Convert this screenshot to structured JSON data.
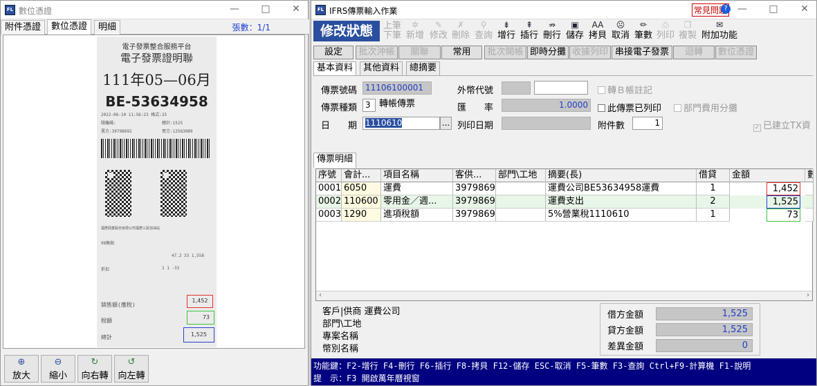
{
  "left_window": {
    "title": "數位憑證",
    "controls": {
      "min": "—",
      "max": "□",
      "close": "✕"
    },
    "tabs": [
      "附件憑證",
      "數位憑證",
      "明細"
    ],
    "page_count": "張數：1/1",
    "receipt": {
      "header": "電子發票整合服務平台",
      "title": "電子發票證明聯",
      "period": "111年05—06月",
      "number": "BE-53634958",
      "line1": "2022-06-10 11:56:23  格式:25",
      "line2a": "隨機碼:",
      "line2b": "總計:1525",
      "line3a": "賣方:39798692",
      "line3b": "買方:12563089",
      "seller": "福懋興業股份有限公司福懋三民加油站",
      "item": "98無鉛",
      "item_row1": "47.2  33  1,558",
      "item_row2a": "折扣",
      "item_row2b": "1     1   -33",
      "sales_label": "銷售額(應稅)",
      "sales_value": "1,452",
      "tax_label": "稅額",
      "tax_value": "73",
      "total_label": "總計",
      "total_value": "1,525"
    },
    "buttons": [
      {
        "icon": "⊕",
        "label": "放大"
      },
      {
        "icon": "⊖",
        "label": "縮小"
      },
      {
        "icon": "↻",
        "label": "向右轉"
      },
      {
        "icon": "↺",
        "label": "向左轉"
      }
    ]
  },
  "right_window": {
    "title": "IFRS傳票輸入作業",
    "help_badge": "常見問題",
    "help_icon": "?",
    "controls": {
      "min": "—",
      "max": "□",
      "close": "✕"
    },
    "state": "修改狀態",
    "toolbar": [
      {
        "icon": "▲",
        "label": "上筆",
        "enabled": false
      },
      {
        "icon": "✲",
        "label": "新增",
        "enabled": false
      },
      {
        "icon": "✎",
        "label": "修改",
        "enabled": false
      },
      {
        "icon": "✗",
        "label": "刪除",
        "enabled": false
      },
      {
        "icon": "⚲",
        "label": "查詢",
        "enabled": false
      },
      {
        "icon": "⇟",
        "label": "增行",
        "enabled": true
      },
      {
        "icon": "⇞",
        "label": "插行",
        "enabled": true
      },
      {
        "icon": "⇏",
        "label": "刪行",
        "enabled": true
      },
      {
        "icon": "▣",
        "label": "儲存",
        "enabled": true
      },
      {
        "icon": "AA",
        "label": "拷貝",
        "enabled": true
      },
      {
        "icon": "☹",
        "label": "取消",
        "enabled": true
      },
      {
        "icon": "✏",
        "label": "筆數",
        "enabled": true
      },
      {
        "icon": "⎙",
        "label": "列印",
        "enabled": false
      },
      {
        "icon": "❐",
        "label": "複製",
        "enabled": false
      },
      {
        "icon": "✉",
        "label": "附加功能",
        "enabled": true
      }
    ],
    "toolbar_row2": [
      "下筆"
    ],
    "func_buttons": [
      {
        "label": "設定",
        "enabled": true
      },
      {
        "label": "批次沖帳",
        "enabled": false
      },
      {
        "label": "關聯",
        "enabled": false
      },
      {
        "label": "常用",
        "enabled": true
      },
      {
        "label": "批次開帳",
        "enabled": false
      },
      {
        "label": "即時分攤",
        "enabled": true
      },
      {
        "label": "收據列印",
        "enabled": false
      },
      {
        "label": "串接電子發票",
        "enabled": true
      },
      {
        "label": "迴轉",
        "enabled": false
      },
      {
        "label": "數位憑證",
        "enabled": false
      }
    ],
    "panel_tabs": [
      "基本資料",
      "其他資料",
      "總摘要"
    ],
    "basic": {
      "voucher_no_label": "傳票號碼",
      "voucher_no": "11106100001",
      "voucher_type_label": "傳票種類",
      "voucher_type_code": "3",
      "voucher_type_name": "轉帳傳票",
      "date_label": "日　　期",
      "date": "1110610",
      "date_btn": "...",
      "currency_label": "外幣代號",
      "currency": "",
      "rate_label": "匯　　率",
      "rate": "1.0000",
      "print_date_label": "列印日期",
      "print_date": "",
      "attach_label": "附件數",
      "attach": "1",
      "chk_transfer_b": "轉Ｂ帳註記",
      "chk_printed": "此傳票已列印",
      "chk_dept_alloc": "部門費用分攤",
      "chk_tx": "已建立TX資"
    },
    "detail_tab": "傳票明細",
    "grid": {
      "headers": [
        "序號",
        "會計...",
        "項目名稱",
        "客供...",
        "部門\\工地",
        "摘要(長)",
        "借貸",
        "金額",
        "數"
      ],
      "rows": [
        [
          "0001",
          "6050",
          "運費",
          "39798692",
          "",
          "運費公司BE53634958運費",
          "1",
          "1,452"
        ],
        [
          "0002",
          "110600",
          "零用金／週...",
          "39798692",
          "",
          "運費支出",
          "2",
          "1,525"
        ],
        [
          "0003",
          "1290",
          "進項稅額",
          "39798692",
          "",
          "5%營業稅1110610",
          "1",
          "73"
        ]
      ]
    },
    "footer_left": {
      "customer": "客戶|供商 運費公司",
      "dept": "部門\\工地",
      "project": "專案名稱",
      "currency": "幣別名稱"
    },
    "totals": {
      "debit_label": "借方金額",
      "debit": "1,525",
      "credit_label": "貸方金額",
      "credit": "1,525",
      "diff_label": "差異金額",
      "diff": "0"
    },
    "status": {
      "line1": "功能鍵：F2-增行 F4-刪行 F6-插行 F8-拷貝 F12-儲存 ESC-取消 F5-筆數 F3-查詢 Ctrl+F9-計算機 F1-說明",
      "line2": "提　示：F3 開啟萬年曆視窗"
    },
    "colors": {
      "state_bg": "#2a4fa0",
      "status_bg": "#000080",
      "amount": "#1f3fc4",
      "red_box": "#e0302a",
      "blue_box": "#2a3fd0",
      "green_box": "#3cc43c"
    }
  }
}
